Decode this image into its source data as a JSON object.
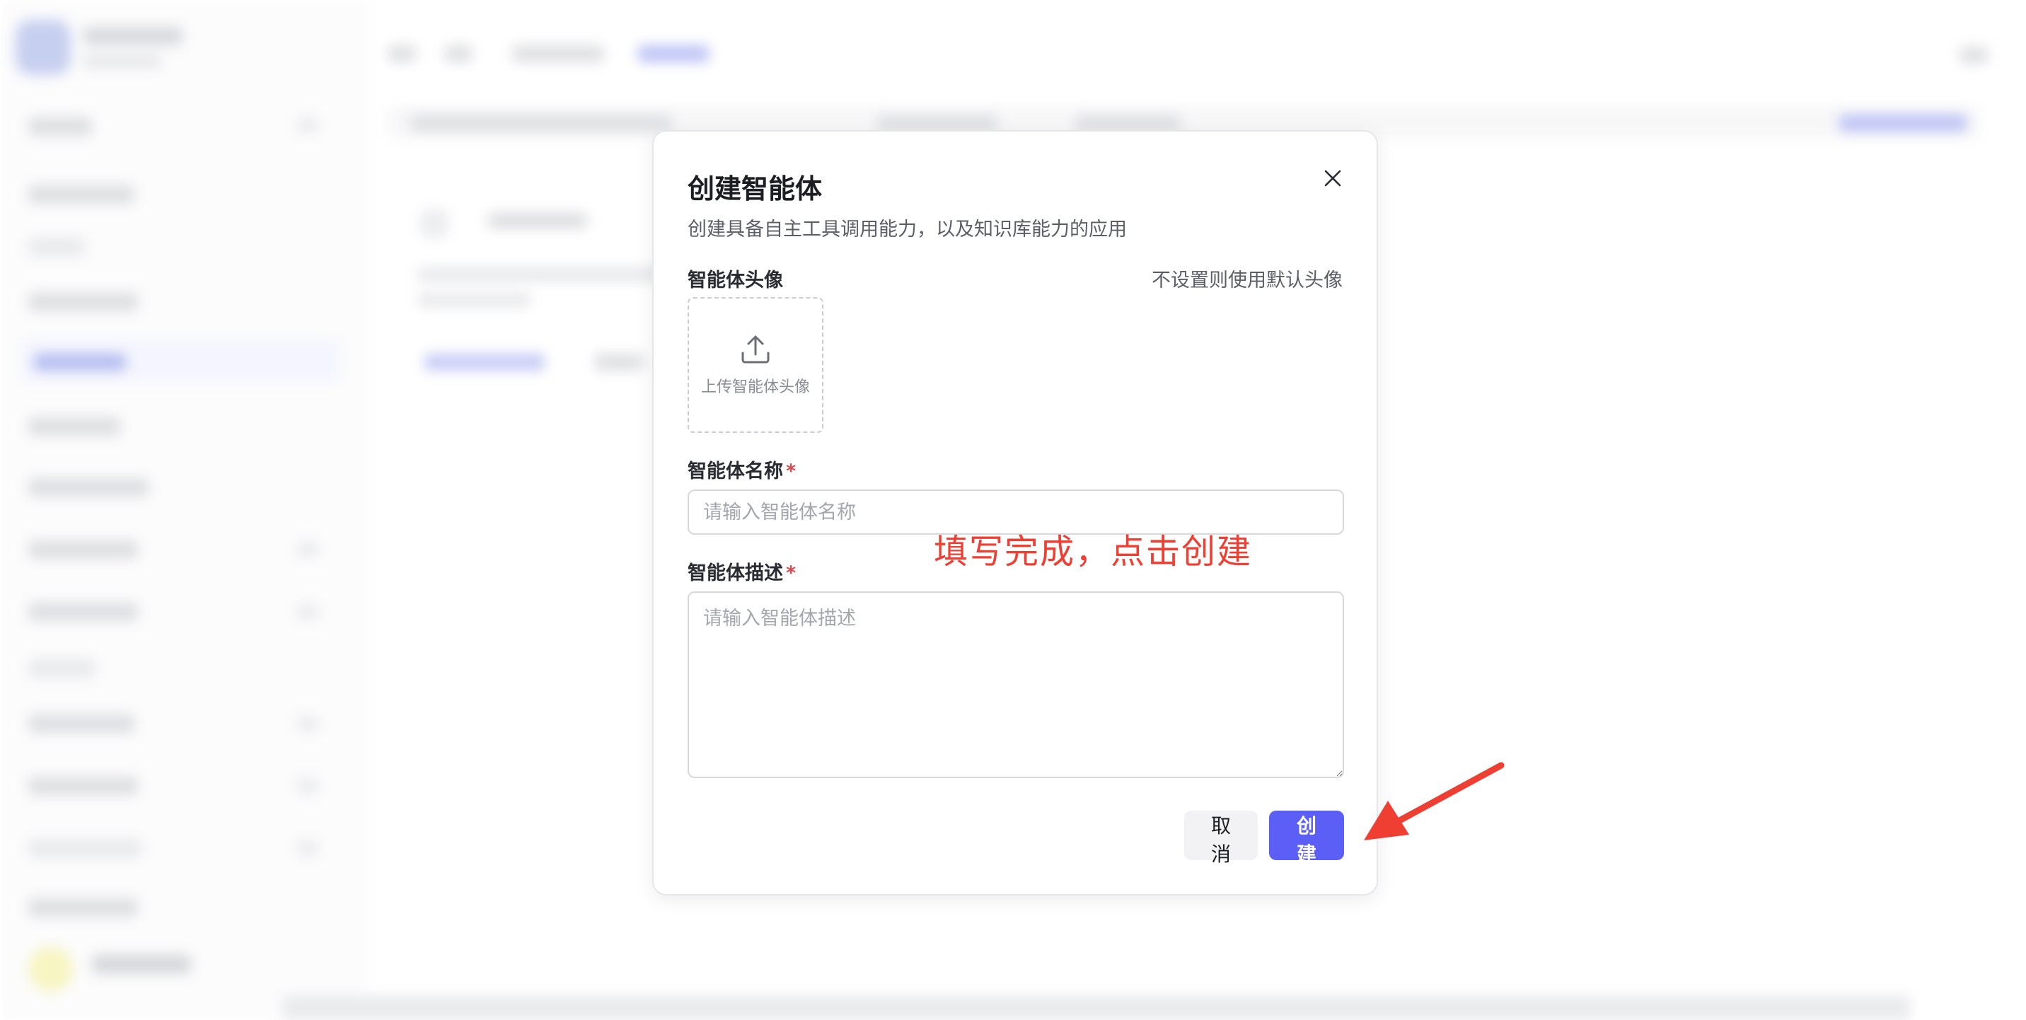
{
  "modal": {
    "title": "创建智能体",
    "subtitle": "创建具备自主工具调用能力，以及知识库能力的应用",
    "avatar": {
      "label": "智能体头像",
      "hint": "不设置则使用默认头像",
      "upload_text": "上传智能体头像"
    },
    "name_field": {
      "label": "智能体名称",
      "required_mark": "*",
      "placeholder": "请输入智能体名称",
      "value": ""
    },
    "description_field": {
      "label": "智能体描述",
      "required_mark": "*",
      "placeholder": "请输入智能体描述",
      "value": ""
    },
    "cancel_label": "取消",
    "create_label": "创建"
  },
  "annotation": {
    "text": "填写完成，点击创建",
    "color": "#ef3e32"
  },
  "colors": {
    "primary": "#5b5ff5",
    "required": "#e0464a"
  },
  "icons": {
    "close": "close-icon",
    "upload": "upload-icon",
    "arrow": "arrow-icon"
  }
}
